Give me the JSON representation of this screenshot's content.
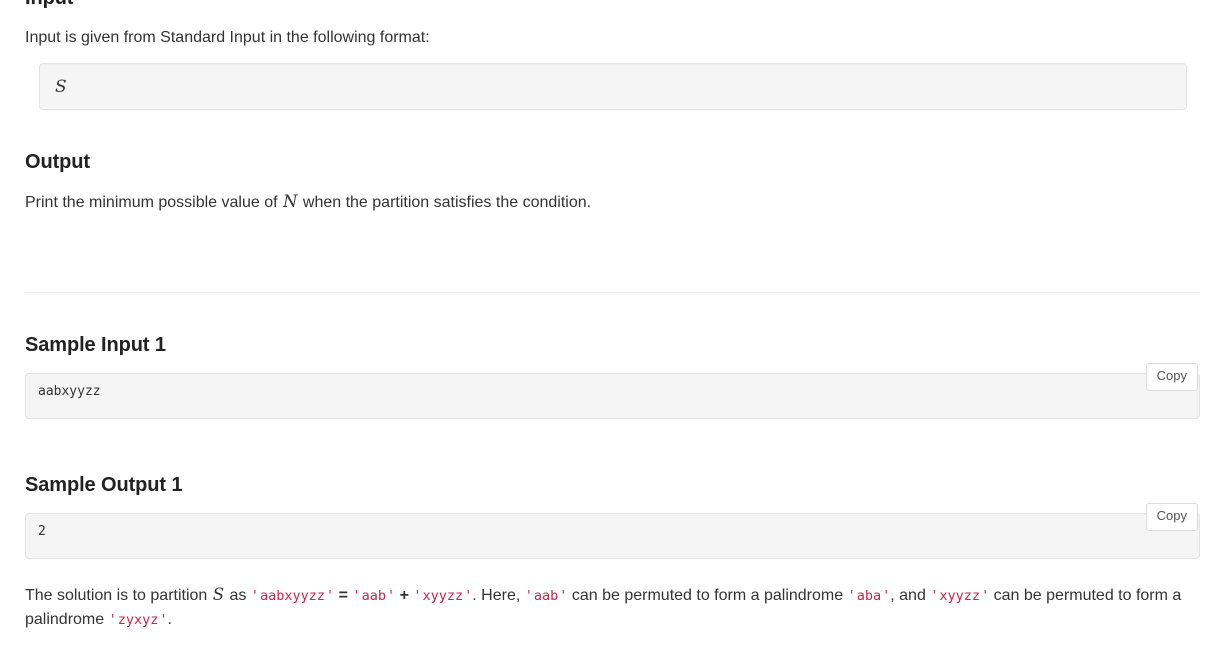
{
  "sections": {
    "input": {
      "title": "Input",
      "description_prefix": "Input is given from Standard Input in the following format:",
      "format_variable": "S"
    },
    "output": {
      "title": "Output",
      "text_before_var": "Print the minimum possible value of ",
      "variable": "N",
      "text_after_var": " when the partition satisfies the condition."
    },
    "sample_input_1": {
      "title": "Sample Input 1",
      "content": "aabxyyzz",
      "copy_label": "Copy"
    },
    "sample_output_1": {
      "title": "Sample Output 1",
      "content": "2",
      "copy_label": "Copy"
    }
  },
  "explanation": {
    "part1": "The solution is to partition ",
    "variable_s": "S",
    "part2": " as ",
    "quote": "'",
    "code_full": "aabxyyzz",
    "equals": "=",
    "code_left": "aab",
    "plus": "+",
    "code_right": "xyyzz",
    "part3": ". Here, ",
    "code_aab": "aab",
    "part4": " can be permuted to form a palindrome ",
    "code_aba": "aba",
    "part5": ", and ",
    "code_xyyzz": "xyyzz",
    "part6": " can be permuted to form a palindrome ",
    "code_zyxyz": "zyxyz",
    "part7": "."
  },
  "colors": {
    "code_crimson": "#c7254e",
    "block_background": "#f5f5f5",
    "block_border": "#e2e2e2",
    "text": "#333333",
    "heading": "#222222",
    "divider": "#eeeeee"
  }
}
